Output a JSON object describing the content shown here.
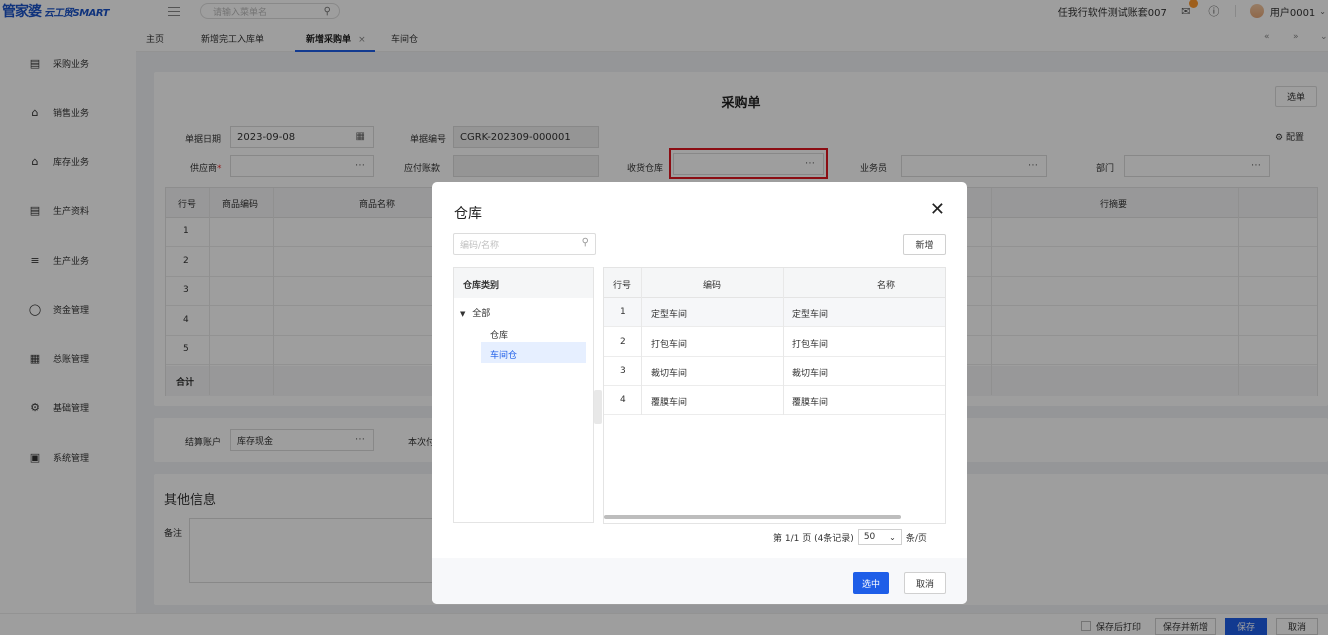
{
  "app": {
    "logo_main": "管家婆",
    "logo_sub": "云工贸SMART"
  },
  "topbar": {
    "menu_search_placeholder": "请输入菜单名",
    "company": "任我行软件测试账套007",
    "user": "用户0001"
  },
  "sidebar": {
    "items": [
      {
        "label": "采购业务",
        "icon": "cart-icon"
      },
      {
        "label": "销售业务",
        "icon": "sales-icon"
      },
      {
        "label": "库存业务",
        "icon": "warehouse-icon"
      },
      {
        "label": "生产资料",
        "icon": "document-icon"
      },
      {
        "label": "生产业务",
        "icon": "sliders-icon"
      },
      {
        "label": "资金管理",
        "icon": "money-icon"
      },
      {
        "label": "总账管理",
        "icon": "ledger-icon"
      },
      {
        "label": "基础管理",
        "icon": "settings-icon"
      },
      {
        "label": "系统管理",
        "icon": "system-icon"
      }
    ]
  },
  "tabs": {
    "items": [
      {
        "label": "主页"
      },
      {
        "label": "新增完工入库单"
      },
      {
        "label": "新增采购单"
      },
      {
        "label": "车间仓"
      }
    ],
    "close_glyph": "×",
    "nav_first": "«",
    "nav_last": "»",
    "nav_more": "⌄"
  },
  "form": {
    "title": "采购单",
    "select_order_btn": "选单",
    "config_label": "配置",
    "fields": {
      "date_label": "单据日期",
      "date_value": "2023-09-08",
      "no_label": "单据编号",
      "no_value": "CGRK-202309-000001",
      "supplier_label": "供应商",
      "payable_label": "应付账款",
      "warehouse_label": "收货仓库",
      "salesman_label": "业务员",
      "dept_label": "部门"
    },
    "grid": {
      "headers": [
        "行号",
        "商品编码",
        "商品名称",
        "行摘要"
      ],
      "rows": [
        "1",
        "2",
        "3",
        "4",
        "5"
      ],
      "sum_label": "合计"
    },
    "settle": {
      "account_label": "结算账户",
      "account_value": "库存现金",
      "current_label": "本次付"
    },
    "other": {
      "title": "其他信息",
      "remark_label": "备注"
    }
  },
  "bottombar": {
    "print_after_save": "保存后打印",
    "save_and_new": "保存并新增",
    "save": "保存",
    "cancel": "取消"
  },
  "modal": {
    "title": "仓库",
    "search_placeholder": "编码/名称",
    "add_btn": "新增",
    "tree": {
      "header": "仓库类别",
      "root": "全部",
      "children": [
        "仓库",
        "车间仓"
      ]
    },
    "table": {
      "headers": [
        "行号",
        "编码",
        "名称"
      ],
      "rows": [
        {
          "no": "1",
          "code": "定型车间",
          "name": "定型车间"
        },
        {
          "no": "2",
          "code": "打包车间",
          "name": "打包车间"
        },
        {
          "no": "3",
          "code": "裁切车间",
          "name": "裁切车间"
        },
        {
          "no": "4",
          "code": "覆膜车间",
          "name": "覆膜车间"
        }
      ]
    },
    "pager": {
      "summary": "第 1/1 页 (4条记录)",
      "page_size": "50",
      "per_page": "条/页"
    },
    "confirm_btn": "选中",
    "cancel_btn": "取消"
  }
}
